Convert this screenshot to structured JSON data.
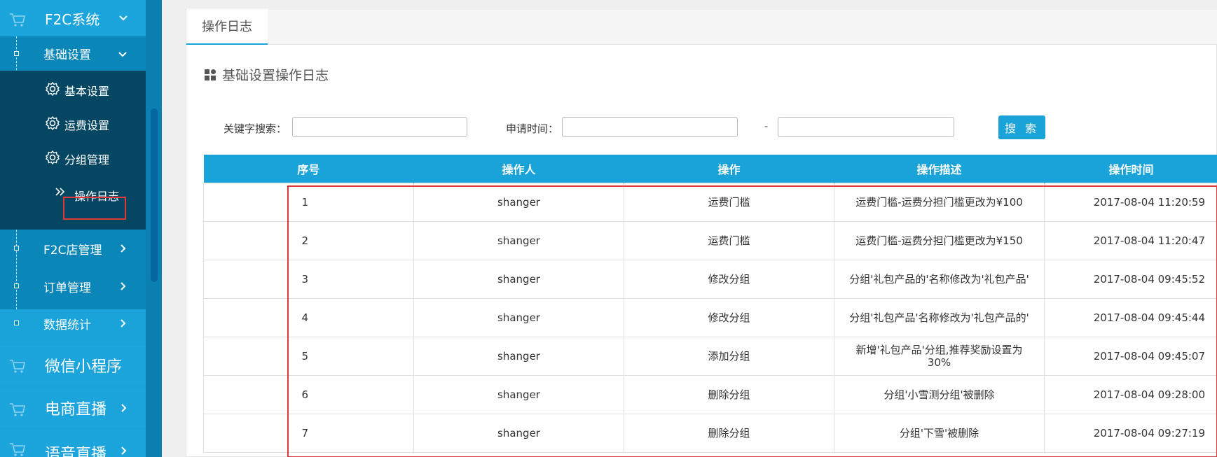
{
  "sidebar": {
    "top": {
      "label": "F2C系统"
    },
    "basic": {
      "label": "基础设置"
    },
    "deep_items": [
      {
        "label": "基本设置"
      },
      {
        "label": "运费设置"
      },
      {
        "label": "分组管理"
      },
      {
        "label": "操作日志"
      }
    ],
    "sub_items": [
      {
        "label": "F2C店管理"
      },
      {
        "label": "订单管理"
      },
      {
        "label": "数据统计"
      }
    ],
    "big_items": [
      {
        "label": "微信小程序"
      },
      {
        "label": "电商直播"
      },
      {
        "label": "语音直播"
      }
    ]
  },
  "main": {
    "tab": "操作日志",
    "section_title": "基础设置操作日志",
    "search": {
      "keyword_label": "关键字搜索：",
      "keyword_value": "",
      "time_label": "申请时间：",
      "start_value": "",
      "end_value": "",
      "separator": "-",
      "button": "搜 索"
    },
    "table": {
      "headers": [
        "序号",
        "操作人",
        "操作",
        "操作描述",
        "操作时间"
      ],
      "rows": [
        [
          "1",
          "shanger",
          "运费门槛",
          "运费门槛-运费分担门槛更改为¥100",
          "2017-08-04 11:20:59"
        ],
        [
          "2",
          "shanger",
          "运费门槛",
          "运费门槛-运费分担门槛更改为¥150",
          "2017-08-04 11:20:47"
        ],
        [
          "3",
          "shanger",
          "修改分组",
          "分组'礼包产品的'名称修改为'礼包产品'",
          "2017-08-04 09:45:52"
        ],
        [
          "4",
          "shanger",
          "修改分组",
          "分组'礼包产品'名称修改为'礼包产品的'",
          "2017-08-04 09:45:44"
        ],
        [
          "5",
          "shanger",
          "添加分组",
          "新增'礼包产品'分组,推荐奖励设置为30%",
          "2017-08-04 09:45:07"
        ],
        [
          "6",
          "shanger",
          "删除分组",
          "分组'小雪测分组'被删除",
          "2017-08-04 09:28:00"
        ],
        [
          "7",
          "shanger",
          "删除分组",
          "分组'下雪'被删除",
          "2017-08-04 09:27:19"
        ]
      ]
    }
  },
  "colors": {
    "accent": "#1aa3d9",
    "sidebar_dark": "#054763",
    "highlight_border": "#e03838"
  },
  "icons": [
    "cart-icon",
    "chevron-down-icon",
    "chevron-right-icon",
    "gear-icon",
    "double-chevron-icon",
    "grid-icon"
  ]
}
